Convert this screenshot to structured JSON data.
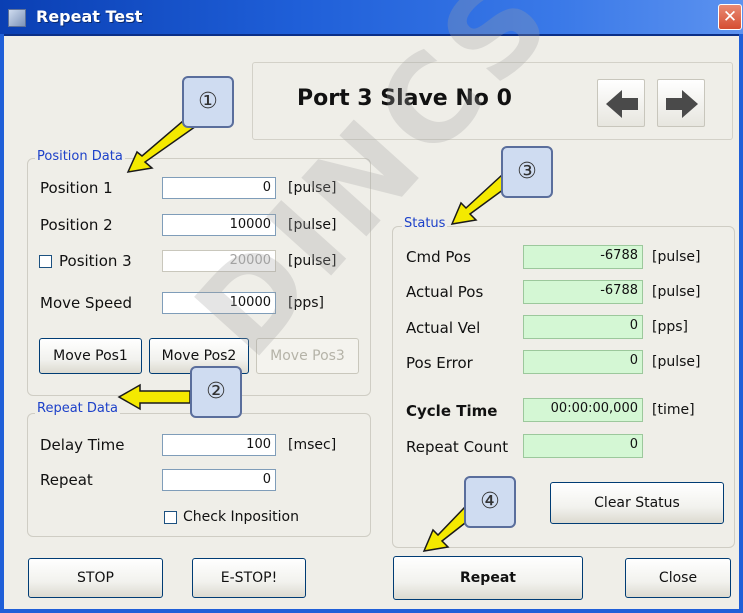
{
  "window": {
    "title": "Repeat Test",
    "close_glyph": "✕"
  },
  "header": {
    "port_title": "Port 3 Slave No 0",
    "prev_icon": "arrow-left-icon",
    "next_icon": "arrow-right-icon"
  },
  "position_data": {
    "group_label": "Position Data",
    "rows": [
      {
        "label": "Position 1",
        "value": "0",
        "unit": "[pulse]"
      },
      {
        "label": "Position 2",
        "value": "10000",
        "unit": "[pulse]"
      },
      {
        "label": "Position 3",
        "value": "20000",
        "unit": "[pulse]",
        "checked": false
      },
      {
        "label": "Move Speed",
        "value": "10000",
        "unit": "[pps]"
      }
    ],
    "buttons": [
      "Move Pos1",
      "Move Pos2",
      "Move Pos3"
    ]
  },
  "repeat_data": {
    "group_label": "Repeat Data",
    "delay_label": "Delay Time",
    "delay_value": "100",
    "delay_unit": "[msec]",
    "repeat_label": "Repeat",
    "repeat_value": "0",
    "check_inposition_label": "Check Inposition",
    "check_inposition_checked": false
  },
  "status": {
    "group_label": "Status",
    "rows": [
      {
        "label": "Cmd Pos",
        "value": "-6788",
        "unit": "[pulse]"
      },
      {
        "label": "Actual Pos",
        "value": "-6788",
        "unit": "[pulse]"
      },
      {
        "label": "Actual Vel",
        "value": "0",
        "unit": "[pps]"
      },
      {
        "label": "Pos Error",
        "value": "0",
        "unit": "[pulse]"
      }
    ],
    "cycle_time_label": "Cycle Time",
    "cycle_time_value": "00:00:00,000",
    "cycle_time_unit": "[time]",
    "repeat_count_label": "Repeat Count",
    "repeat_count_value": "0",
    "clear_status": "Clear Status"
  },
  "footer": {
    "stop": "STOP",
    "estop": "E-STOP!",
    "repeat": "Repeat",
    "close": "Close"
  },
  "callouts": [
    "①",
    "②",
    "③",
    "④"
  ],
  "watermark": "DINCS",
  "colors": {
    "titlebar": "#1f5fd8",
    "group_label": "#1d41c9",
    "status_field": "#d4f7d4",
    "callout_arrow": "#f4e900"
  }
}
